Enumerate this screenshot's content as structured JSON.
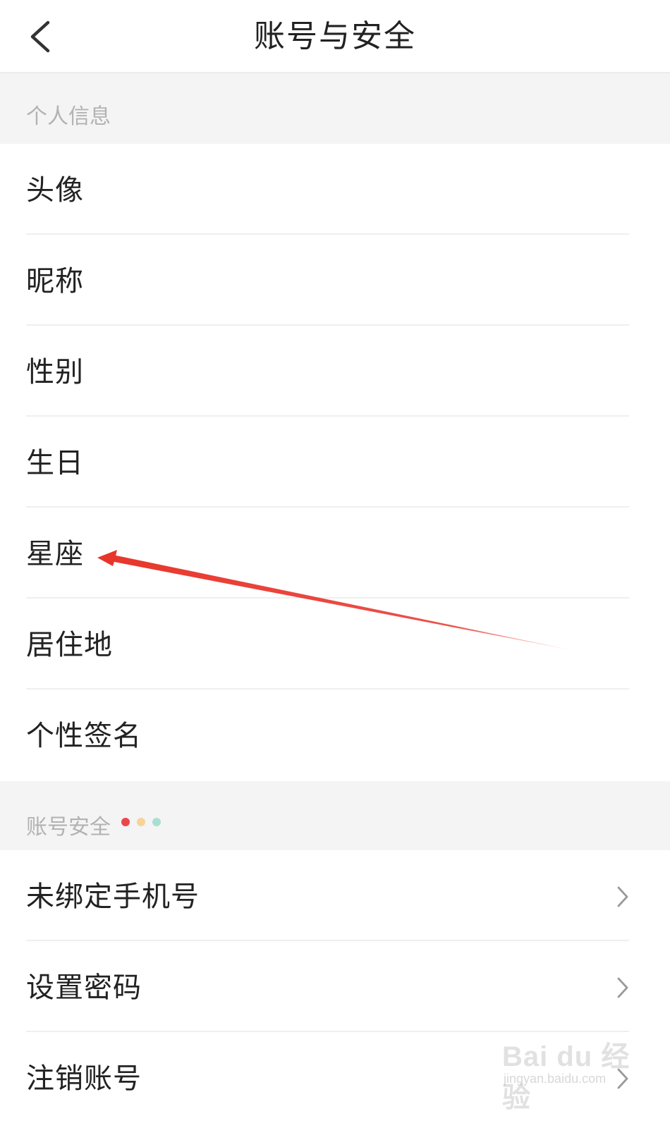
{
  "header": {
    "title": "账号与安全",
    "back_icon": "chevron-left-icon"
  },
  "sections": [
    {
      "title": "个人信息",
      "items": [
        {
          "label": "头像"
        },
        {
          "label": "昵称"
        },
        {
          "label": "性别"
        },
        {
          "label": "生日"
        },
        {
          "label": "星座"
        },
        {
          "label": "居住地"
        },
        {
          "label": "个性签名"
        }
      ]
    },
    {
      "title": "账号安全",
      "indicator_dot_colors": [
        "#e8474d",
        "#f7d39a",
        "#a9dfd0"
      ],
      "items": [
        {
          "label": "未绑定手机号",
          "icon": "chevron-right-icon"
        },
        {
          "label": "设置密码",
          "icon": "chevron-right-icon"
        },
        {
          "label": "注销账号",
          "icon": "chevron-right-icon"
        }
      ]
    }
  ],
  "annotation": {
    "type": "arrow",
    "color": "#e8352b",
    "points_to": "星座"
  },
  "watermark": {
    "logo": "Bai du 经验",
    "url": "jingyan.baidu.com"
  },
  "colors": {
    "section_background": "#f4f4f4",
    "section_label": "#b2b2b2",
    "item_text": "#222222",
    "divider": "#efefef",
    "chevron": "#9a9a9a"
  }
}
